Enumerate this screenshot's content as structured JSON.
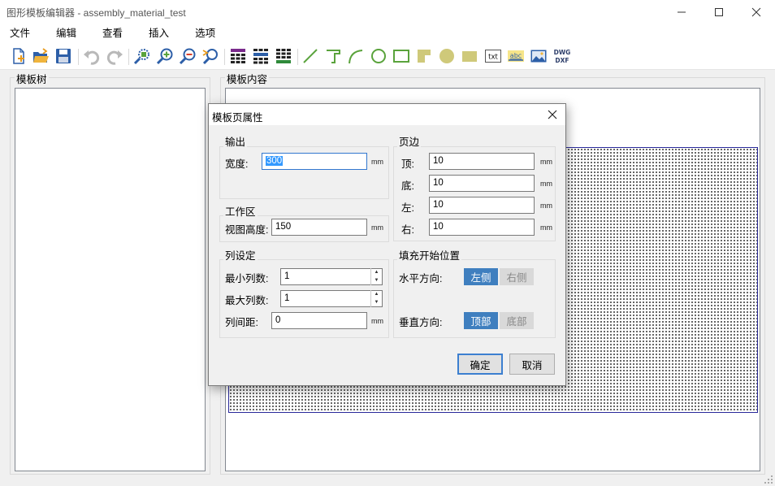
{
  "window": {
    "title": "图形模板编辑器 - assembly_material_test"
  },
  "menu": [
    "文件",
    "编辑",
    "查看",
    "插入",
    "选项"
  ],
  "toolbar": {
    "icons": [
      "new-file-icon",
      "open-folder-icon",
      "save-icon",
      "undo-icon",
      "redo-icon",
      "zoom-fit-icon",
      "zoom-in-icon",
      "zoom-out-icon",
      "zoom-reset-icon",
      "table-icon",
      "table-blue-icon",
      "table-green-icon",
      "line-icon",
      "polyline-icon",
      "arc-icon",
      "circle-icon",
      "rectangle-icon",
      "fill-polygon-icon",
      "fill-circle-icon",
      "fill-rect-icon",
      "text-icon",
      "abc-text-icon",
      "image-icon",
      "dwg-dxf-icon"
    ],
    "txt_label": "txt",
    "abc_label": "abc",
    "dwg_label": "DWG",
    "dxf_label": "DXF"
  },
  "panels": {
    "tree_title": "模板树",
    "content_title": "模板内容"
  },
  "dialog": {
    "title": "模板页属性",
    "output": {
      "title": "输出",
      "width_label": "宽度:",
      "width_value": "300",
      "unit": "mm"
    },
    "workarea": {
      "title": "工作区",
      "height_label": "视图高度:",
      "height_value": "150",
      "unit": "mm"
    },
    "columns": {
      "title": "列设定",
      "min_label": "最小列数:",
      "min_value": "1",
      "max_label": "最大列数:",
      "max_value": "1",
      "gap_label": "列间距:",
      "gap_value": "0",
      "unit": "mm"
    },
    "margins": {
      "title": "页边",
      "top_label": "顶:",
      "top_value": "10",
      "bottom_label": "底:",
      "bottom_value": "10",
      "left_label": "左:",
      "left_value": "10",
      "right_label": "右:",
      "right_value": "10",
      "unit": "mm"
    },
    "fill_start": {
      "title": "填充开始位置",
      "horizontal_label": "水平方向:",
      "left_option": "左侧",
      "right_option": "右侧",
      "vertical_label": "垂直方向:",
      "top_option": "顶部",
      "bottom_option": "底部"
    },
    "ok_label": "确定",
    "cancel_label": "取消"
  }
}
